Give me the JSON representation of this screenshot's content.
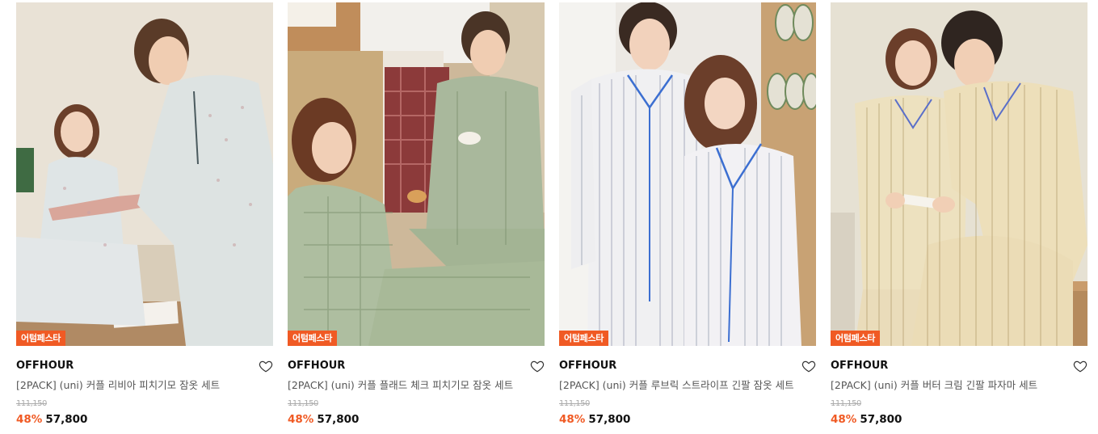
{
  "products": [
    {
      "badge": "어텀페스타",
      "brand": "OFFHOUR",
      "title": "[2PACK] (uni) 커플 리비아 피치기모 잠옷 세트",
      "original_price": "111,150",
      "discount": "48%",
      "price": "57,800",
      "image_theme": "floral-pajama-couple"
    },
    {
      "badge": "어텀페스타",
      "brand": "OFFHOUR",
      "title": "[2PACK] (uni) 커플 플래드 체크 피치기모 잠옷 세트",
      "original_price": "111,150",
      "discount": "48%",
      "price": "57,800",
      "image_theme": "green-check-pajama-couple"
    },
    {
      "badge": "어텀페스타",
      "brand": "OFFHOUR",
      "title": "[2PACK] (uni) 커플 루브릭 스트라이프 긴팔 잠옷 세트",
      "original_price": "111,150",
      "discount": "48%",
      "price": "57,800",
      "image_theme": "blue-stripe-pajama-couple"
    },
    {
      "badge": "어텀페스타",
      "brand": "OFFHOUR",
      "title": "[2PACK] (uni) 커플 버터 크림 긴팔 파자마 세트",
      "original_price": "111,150",
      "discount": "48%",
      "price": "57,800",
      "image_theme": "butter-cream-stripe-couple"
    }
  ],
  "colors": {
    "badge_bg": "#f05a24",
    "discount": "#f05a24"
  },
  "icons": {
    "wishlist": "heart-outline-icon"
  }
}
